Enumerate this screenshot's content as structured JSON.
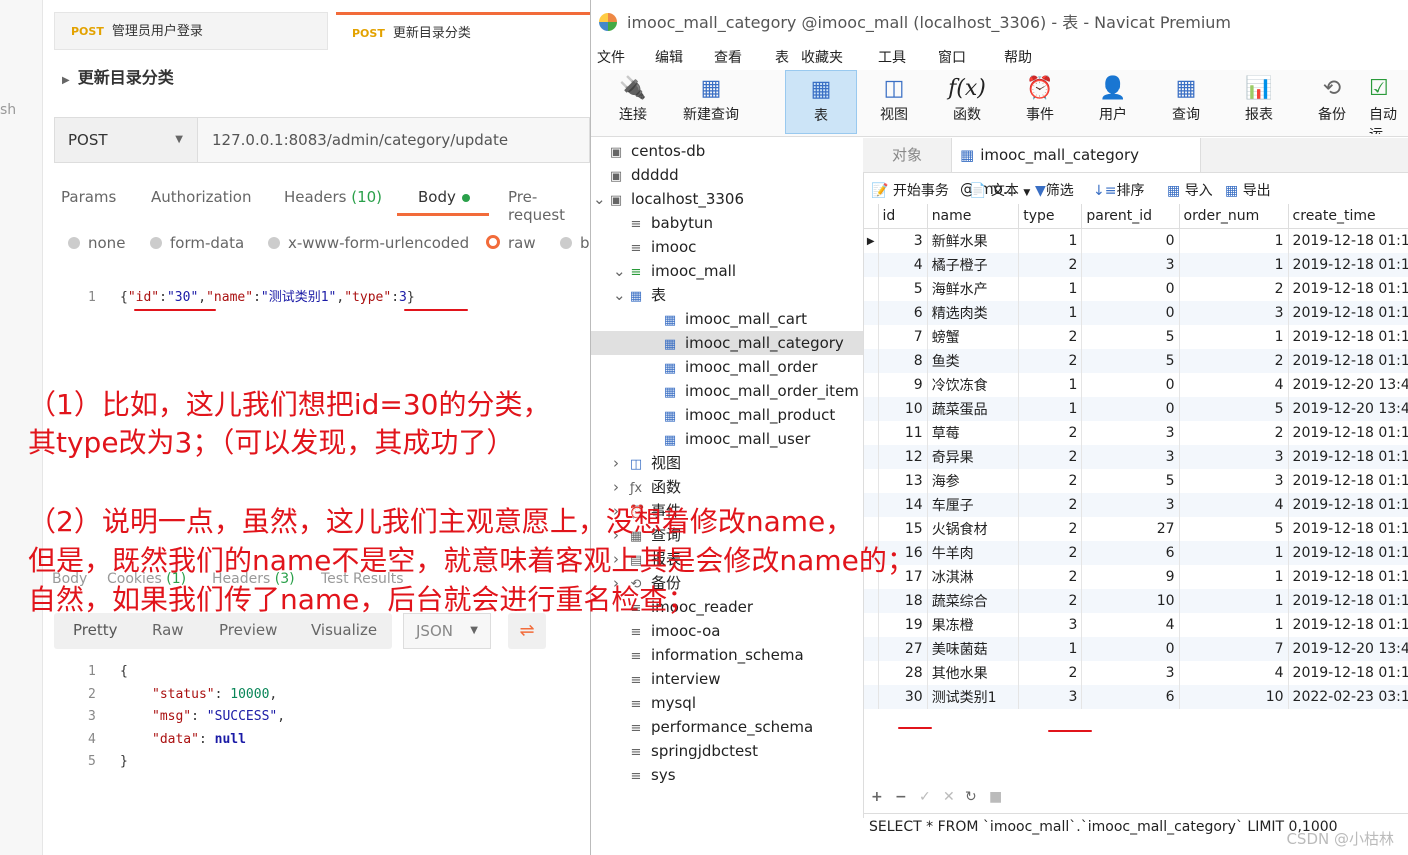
{
  "postman": {
    "tabs": [
      {
        "method": "POST",
        "label": "管理员用户登录"
      },
      {
        "method": "POST",
        "label": "更新目录分类"
      }
    ],
    "side_text": "sh",
    "request_title": "更新目录分类",
    "method": "POST",
    "url": "127.0.0.1:8083/admin/category/update",
    "subtabs": {
      "params": "Params",
      "authorization": "Authorization",
      "headers": "Headers",
      "headers_count": "(10)",
      "body": "Body",
      "prerequest": "Pre-request"
    },
    "body_types": {
      "none": "none",
      "form_data": "form-data",
      "urlencoded": "x-www-form-urlencoded",
      "raw": "raw",
      "binary": "b"
    },
    "request_body": {
      "line": "1",
      "p1": "{",
      "k1": "\"id\"",
      "c1": ":",
      "v1": "\"30\"",
      "s1": ",",
      "k2": "\"name\"",
      "c2": ":",
      "v2": "\"测试类别1\"",
      "s2": ",",
      "k3": "\"type\"",
      "c3": ":",
      "v3": "3",
      "p2": "}"
    },
    "response_tabs": {
      "body": "Body",
      "cookies": "Cookies",
      "cookies_count": "(1)",
      "headers": "Headers",
      "headers_count": "(3)",
      "test_results": "Test Results"
    },
    "response_views": {
      "pretty": "Pretty",
      "raw": "Raw",
      "preview": "Preview",
      "visualize": "Visualize",
      "format": "JSON"
    },
    "response_lines": [
      {
        "n": "1",
        "text": "{"
      },
      {
        "n": "2",
        "key": "\"status\"",
        "sep": ": ",
        "val": "10000",
        "tail": ","
      },
      {
        "n": "3",
        "key": "\"msg\"",
        "sep": ": ",
        "val": "\"SUCCESS\"",
        "tail": ","
      },
      {
        "n": "4",
        "key": "\"data\"",
        "sep": ": ",
        "val": "null",
        "tail": ""
      },
      {
        "n": "5",
        "text": "}"
      }
    ]
  },
  "navicat": {
    "title": "imooc_mall_category @imooc_mall (localhost_3306) - 表 - Navicat Premium",
    "menu": [
      "文件",
      "编辑",
      "查看",
      "表",
      "收藏夹",
      "工具",
      "窗口",
      "帮助"
    ],
    "toolbar": [
      {
        "label": "连接",
        "icon": "connect-icon"
      },
      {
        "label": "新建查询",
        "icon": "new-query-icon"
      },
      {
        "label": "表",
        "icon": "table-icon"
      },
      {
        "label": "视图",
        "icon": "view-icon"
      },
      {
        "label": "函数",
        "icon": "function-icon"
      },
      {
        "label": "事件",
        "icon": "event-icon"
      },
      {
        "label": "用户",
        "icon": "user-icon"
      },
      {
        "label": "查询",
        "icon": "query-icon"
      },
      {
        "label": "报表",
        "icon": "report-icon"
      },
      {
        "label": "备份",
        "icon": "backup-icon"
      },
      {
        "label": "自动运",
        "icon": "automation-icon"
      }
    ],
    "tree": [
      {
        "label": "centos-db",
        "icon": "connection-icon",
        "level": 0
      },
      {
        "label": "ddddd",
        "icon": "connection-icon",
        "level": 0
      },
      {
        "label": "localhost_3306",
        "icon": "connection-icon",
        "level": 0,
        "expanded": true
      },
      {
        "label": "babytun",
        "icon": "database-icon",
        "level": 1
      },
      {
        "label": "imooc",
        "icon": "database-icon",
        "level": 1
      },
      {
        "label": "imooc_mall",
        "icon": "database-icon",
        "level": 1,
        "expanded": true
      },
      {
        "label": "表",
        "icon": "tables-folder-icon",
        "level": 2,
        "expanded": true
      },
      {
        "label": "imooc_mall_cart",
        "icon": "table-icon",
        "level": 3
      },
      {
        "label": "imooc_mall_category",
        "icon": "table-icon",
        "level": 3,
        "selected": true
      },
      {
        "label": "imooc_mall_order",
        "icon": "table-icon",
        "level": 3
      },
      {
        "label": "imooc_mall_order_item",
        "icon": "table-icon",
        "level": 3
      },
      {
        "label": "imooc_mall_product",
        "icon": "table-icon",
        "level": 3
      },
      {
        "label": "imooc_mall_user",
        "icon": "table-icon",
        "level": 3
      },
      {
        "label": "视图",
        "icon": "views-folder-icon",
        "level": 2,
        "collapsed": true
      },
      {
        "label": "函数",
        "icon": "functions-folder-icon",
        "level": 2,
        "collapsed": true
      },
      {
        "label": "事件",
        "icon": "events-folder-icon",
        "level": 2,
        "collapsed": true
      },
      {
        "label": "查询",
        "icon": "queries-folder-icon",
        "level": 2,
        "collapsed": true
      },
      {
        "label": "报表",
        "icon": "reports-folder-icon",
        "level": 2,
        "collapsed": true
      },
      {
        "label": "备份",
        "icon": "backups-folder-icon",
        "level": 2,
        "collapsed": true
      },
      {
        "label": "imooc_reader",
        "icon": "database-icon",
        "level": 1
      },
      {
        "label": "imooc-oa",
        "icon": "database-icon",
        "level": 1
      },
      {
        "label": "information_schema",
        "icon": "database-icon",
        "level": 1
      },
      {
        "label": "interview",
        "icon": "database-icon",
        "level": 1
      },
      {
        "label": "mysql",
        "icon": "database-icon",
        "level": 1
      },
      {
        "label": "performance_schema",
        "icon": "database-icon",
        "level": 1
      },
      {
        "label": "springjdbctest",
        "icon": "database-icon",
        "level": 1
      },
      {
        "label": "sys",
        "icon": "database-icon",
        "level": 1
      }
    ],
    "object_tab": "对象",
    "current_tab": "imooc_mall_category @imo...",
    "actions": {
      "begin": "开始事务",
      "text": "文本",
      "filter": "筛选",
      "sort": "排序",
      "import": "导入",
      "export": "导出"
    },
    "columns": [
      "id",
      "name",
      "type",
      "parent_id",
      "order_num",
      "create_time"
    ],
    "rows": [
      [
        "3",
        "新鲜水果",
        "1",
        "0",
        "1",
        "2019-12-18 01:1"
      ],
      [
        "4",
        "橘子橙子",
        "2",
        "3",
        "1",
        "2019-12-18 01:1"
      ],
      [
        "5",
        "海鲜水产",
        "1",
        "0",
        "2",
        "2019-12-18 01:1"
      ],
      [
        "6",
        "精选肉类",
        "1",
        "0",
        "3",
        "2019-12-18 01:1"
      ],
      [
        "7",
        "螃蟹",
        "2",
        "5",
        "1",
        "2019-12-18 01:1"
      ],
      [
        "8",
        "鱼类",
        "2",
        "5",
        "2",
        "2019-12-18 01:1"
      ],
      [
        "9",
        "冷饮冻食",
        "1",
        "0",
        "4",
        "2019-12-20 13:4"
      ],
      [
        "10",
        "蔬菜蛋品",
        "1",
        "0",
        "5",
        "2019-12-20 13:4"
      ],
      [
        "11",
        "草莓",
        "2",
        "3",
        "2",
        "2019-12-18 01:1"
      ],
      [
        "12",
        "奇异果",
        "2",
        "3",
        "3",
        "2019-12-18 01:1"
      ],
      [
        "13",
        "海参",
        "2",
        "5",
        "3",
        "2019-12-18 01:1"
      ],
      [
        "14",
        "车厘子",
        "2",
        "3",
        "4",
        "2019-12-18 01:1"
      ],
      [
        "15",
        "火锅食材",
        "2",
        "27",
        "5",
        "2019-12-18 01:1"
      ],
      [
        "16",
        "牛羊肉",
        "2",
        "6",
        "1",
        "2019-12-18 01:1"
      ],
      [
        "17",
        "冰淇淋",
        "2",
        "9",
        "1",
        "2019-12-18 01:1"
      ],
      [
        "18",
        "蔬菜综合",
        "2",
        "10",
        "1",
        "2019-12-18 01:1"
      ],
      [
        "19",
        "果冻橙",
        "3",
        "4",
        "1",
        "2019-12-18 01:1"
      ],
      [
        "27",
        "美味菌菇",
        "1",
        "0",
        "7",
        "2019-12-20 13:4"
      ],
      [
        "28",
        "其他水果",
        "2",
        "3",
        "4",
        "2019-12-18 01:1"
      ],
      [
        "30",
        "测试类别1",
        "3",
        "6",
        "10",
        "2022-02-23 03:1"
      ]
    ],
    "status_sql": "SELECT * FROM `imooc_mall`.`imooc_mall_category` LIMIT 0,1000"
  },
  "annotations": {
    "line1": "（1）比如，这儿我们想把id=30的分类，",
    "line2": "其type改为3；（可以发现，其成功了）",
    "line3": "（2）说明一点，虽然，这儿我们主观意愿上，没想着修改name，",
    "line4": "但是，既然我们的name不是空，就意味着客观上其是会修改name的；",
    "line5": "自然，如果我们传了name，后台就会进行重名检查；"
  },
  "watermark": "CSDN @小枯林",
  "colors": {
    "annotation": "#e1141b",
    "postman_accent": "#f26b3a",
    "postman_method": "#e3a200",
    "selection": "#cce4f7"
  }
}
